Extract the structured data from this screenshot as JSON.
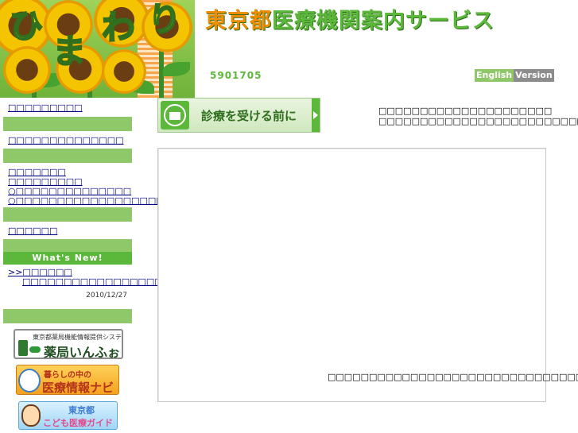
{
  "header": {
    "logo_chars": [
      "ひ",
      "ま",
      "わ",
      "り"
    ],
    "title_part1": "東京都",
    "title_part2": "医療機関案内サービス",
    "counter": "5901705",
    "english_label_1": "English",
    "english_label_2": "Version"
  },
  "sidebar": {
    "link1": "□□□□□□□□□",
    "link2": "□□□□□□□□□□□□□□",
    "link3": "□□□□□□□",
    "link4": "□□□□□□□□□",
    "link5": "○□□□□□□□□□□□□□□",
    "link6": "○□□□□□□□□□□□□□□□□□□□□□□",
    "link7": "□□□□□□",
    "whats_new_heading": "What's New!",
    "news_link": ">>□□□□□□",
    "news_item": "□□□□□□□□□□□□□□□□□□□□□□□□□",
    "news_date": "2010/12/27"
  },
  "banners": {
    "yakkyoku_small": "東京都薬局機能情報提供システム",
    "yakkyoku_big": "薬局いんふぉ",
    "navi_small": "暮らしの中の",
    "navi_big": "医療情報ナビ",
    "kodomo_small": "東京都",
    "kodomo_big": "こども医療ガイド"
  },
  "main": {
    "before_button_label": "診療を受ける前に",
    "intro_line1": "□□□□□□□□□□□□□□□□□□□□□",
    "intro_line2": "□□□□□□□□□□□□□□□□□□□□□□□□□□",
    "panel_note": "□□□□□□□□□□□□□□□□□□□□□□□□□□□□□□□"
  },
  "colors": {
    "accent_green": "#5cb83a",
    "light_green": "#8ec868",
    "title_orange": "#f08c00",
    "link_blue": "#00007f"
  }
}
